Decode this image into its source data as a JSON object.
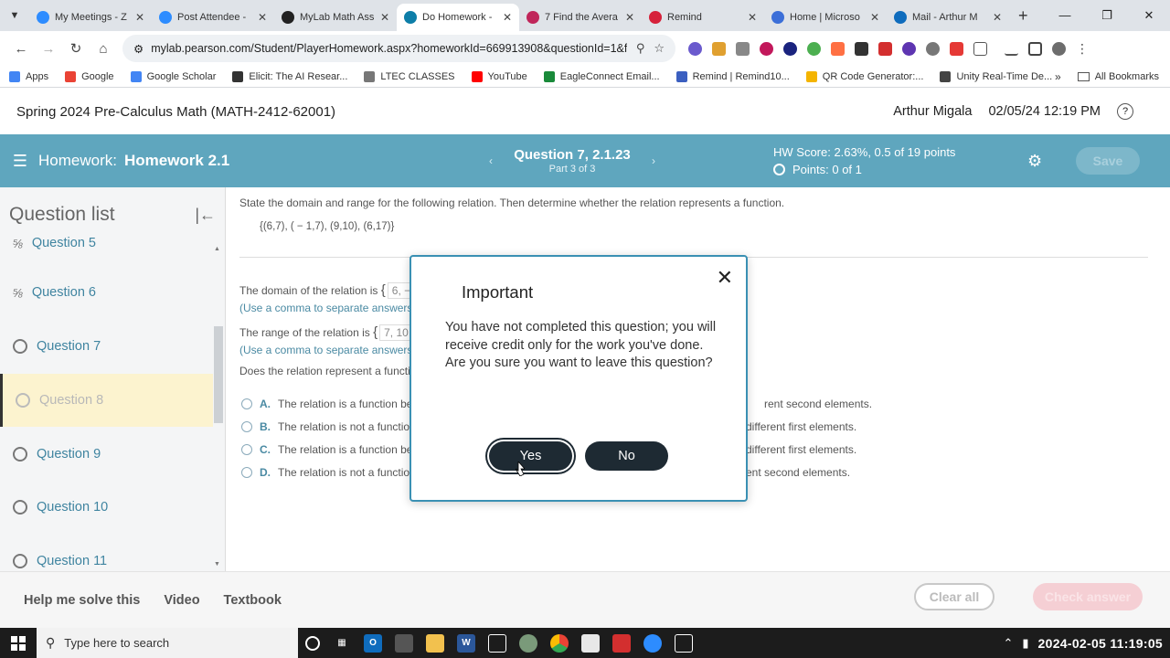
{
  "browser": {
    "tabs": [
      {
        "title": "My Meetings - Z",
        "color": "#2d8cff",
        "icon": "zoom-icon"
      },
      {
        "title": "Post Attendee -",
        "color": "#2d8cff",
        "icon": "zoom-icon"
      },
      {
        "title": "MyLab Math Ass",
        "color": "#222222",
        "icon": "ixl-icon"
      },
      {
        "title": "Do Homework -",
        "color": "#0d7ea8",
        "icon": "pearson-icon",
        "active": true
      },
      {
        "title": "7 Find the Avera",
        "color": "#c0265a",
        "icon": "pinterest-icon"
      },
      {
        "title": "Remind",
        "color": "#d6213a",
        "icon": "remind-icon"
      },
      {
        "title": "Home | Microso",
        "color": "#3c6fd8",
        "icon": "microsoft-icon"
      },
      {
        "title": "Mail - Arthur M",
        "color": "#0f6cbd",
        "icon": "outlook-icon"
      }
    ],
    "url": "mylab.pearson.com/Student/PlayerHomework.aspx?homeworkId=669913908&questionId=1&flushe...",
    "bookmarks": [
      {
        "label": "Apps",
        "color": "#4285f4"
      },
      {
        "label": "Google",
        "color": "#ea4335"
      },
      {
        "label": "Google Scholar",
        "color": "#4285f4"
      },
      {
        "label": "Elicit: The AI Resear...",
        "color": "#333333"
      },
      {
        "label": "LTEC CLASSES",
        "color": "#777777"
      },
      {
        "label": "YouTube",
        "color": "#ff0000"
      },
      {
        "label": "EagleConnect Email...",
        "color": "#1a8a3a"
      },
      {
        "label": "Remind | Remind10...",
        "color": "#3b5fc0"
      },
      {
        "label": "QR Code Generator:...",
        "color": "#f4b400"
      },
      {
        "label": "Unity Real-Time De...",
        "color": "#444444"
      }
    ],
    "all_bookmarks": "All Bookmarks"
  },
  "header": {
    "course": "Spring 2024 Pre-Calculus Math (MATH-2412-62001)",
    "user": "Arthur Migala",
    "datetime": "02/05/24 12:19 PM"
  },
  "hwbar": {
    "label": "Homework:",
    "name": "Homework 2.1",
    "question": "Question 7, 2.1.23",
    "part": "Part 3 of 3",
    "score": "HW Score: 2.63%, 0.5 of 19 points",
    "points": "Points: 0 of 1",
    "save": "Save"
  },
  "qlist": {
    "title": "Question list",
    "items": [
      {
        "label": "Question 5",
        "status": "partial"
      },
      {
        "label": "Question 6",
        "status": "partial"
      },
      {
        "label": "Question 7",
        "status": "open"
      },
      {
        "label": "Question 8",
        "status": "current"
      },
      {
        "label": "Question 9",
        "status": "open"
      },
      {
        "label": "Question 10",
        "status": "open"
      },
      {
        "label": "Question 11",
        "status": "open"
      }
    ]
  },
  "question": {
    "prompt": "State the domain and range for the following relation. Then determine whether the relation represents a function.",
    "relation": "{(6,7), ( − 1,7), (9,10), (6,17)}",
    "domain_label": "The domain of the relation is",
    "domain_value": "6, −",
    "domain_hint": "(Use a comma to separate answers",
    "range_label": "The range of the relation is",
    "range_value": "7, 10,",
    "range_hint": "(Use a comma to separate answers",
    "function_q": "Does the relation represent a functi",
    "options": [
      {
        "letter": "A.",
        "text": "The relation is a function be",
        "tail": "rent second elements."
      },
      {
        "letter": "B.",
        "text": "The relation is not a functio",
        "tail": "different first elements."
      },
      {
        "letter": "C.",
        "text": "The relation is a function be",
        "tail": "different first elements."
      },
      {
        "letter": "D.",
        "text": "The relation is not a functio",
        "tail": "ent second elements."
      }
    ]
  },
  "footer": {
    "help": "Help me solve this",
    "video": "Video",
    "textbook": "Textbook",
    "clear": "Clear all",
    "check": "Check answer"
  },
  "dialog": {
    "title": "Important",
    "body1": "You have not completed this question; you will receive credit only for the work you've done.",
    "body2": "Are you sure you want to leave this question?",
    "yes": "Yes",
    "no": "No"
  },
  "taskbar": {
    "search_placeholder": "Type here to search",
    "clock": "2024-02-05  11:19:05"
  }
}
